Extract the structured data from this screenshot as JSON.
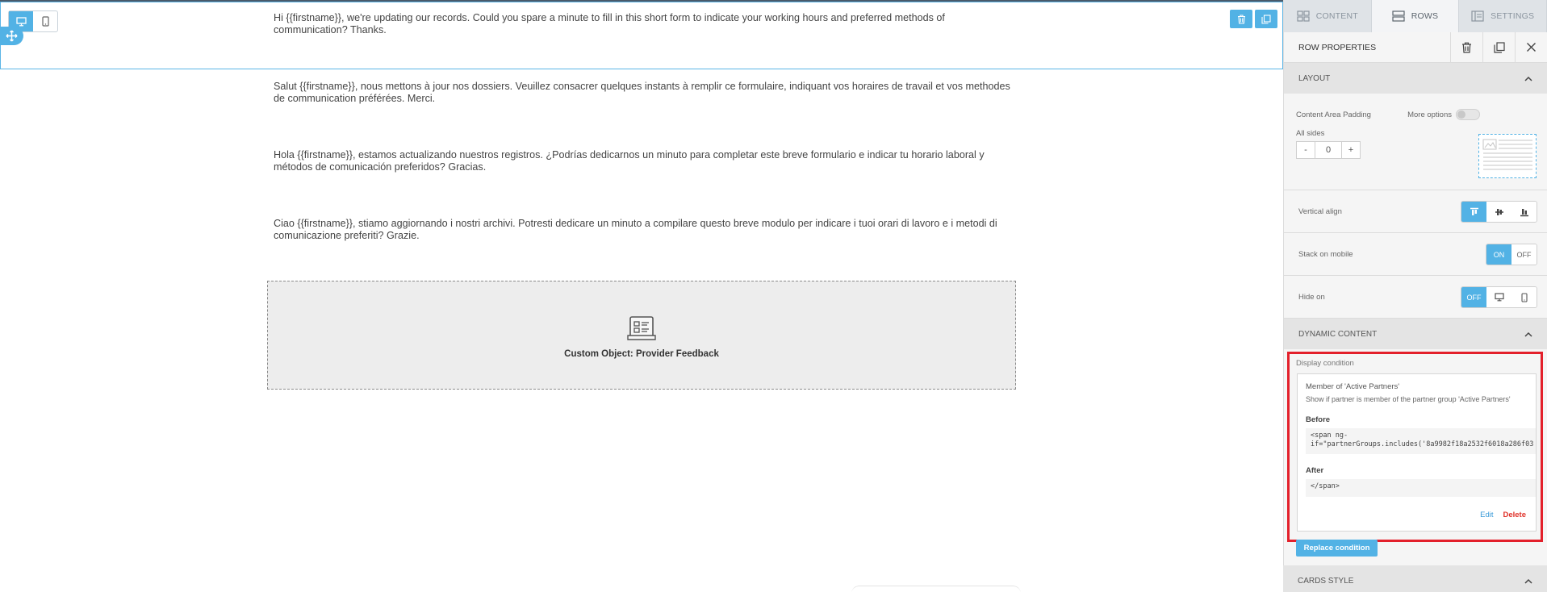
{
  "canvas": {
    "messages": [
      "Hi {{firstname}}, we're updating our records. Could you spare a minute to fill in this short form to indicate your working hours and preferred methods of communication? Thanks.",
      "Salut {{firstname}}, nous mettons à jour nos dossiers. Veuillez consacrer quelques instants à remplir ce formulaire, indiquant vos horaires de travail et vos methodes de communication préférées. Merci.",
      "Hola {{firstname}}, estamos actualizando nuestros registros. ¿Podrías dedicarnos un minuto para completar este breve formulario e indicar tu horario laboral y métodos de comunicación preferidos? Gracias.",
      "Ciao {{firstname}}, stiamo aggiornando i nostri archivi. Potresti dedicare un minuto a compilare questo breve modulo per indicare i tuoi orari di lavoro e i metodi di comunicazione preferiti? Grazie."
    ],
    "custom_object_label": "Custom Object: Provider Feedback"
  },
  "panel": {
    "tabs": [
      {
        "label": "CONTENT",
        "icon": "grid-icon",
        "active": false
      },
      {
        "label": "ROWS",
        "icon": "rows-icon",
        "active": true
      },
      {
        "label": "SETTINGS",
        "icon": "settings-icon",
        "active": false
      }
    ],
    "header_title": "ROW PROPERTIES",
    "layout": {
      "title": "LAYOUT",
      "padding_label": "Content Area Padding",
      "more_options_label": "More options",
      "all_sides_label": "All sides",
      "minus": "-",
      "value": "0",
      "plus": "+"
    },
    "vertical_align_label": "Vertical align",
    "stack_on_mobile": {
      "label": "Stack on mobile",
      "on": "ON",
      "off": "OFF"
    },
    "hide_on": {
      "label": "Hide on",
      "off": "OFF"
    },
    "dynamic_content": {
      "title": "DYNAMIC CONTENT",
      "display_condition_label": "Display condition",
      "condition_title": "Member of 'Active Partners'",
      "condition_desc": "Show if partner is member of the partner group 'Active Partners'",
      "before_label": "Before",
      "before_code": "<span ng-\nif=\"partnerGroups.includes('8a9982f18a2532f6018a286f03",
      "after_label": "After",
      "after_code": "</span>",
      "edit": "Edit",
      "delete": "Delete",
      "replace": "Replace condition"
    },
    "cards_style_title": "CARDS STYLE"
  },
  "colors": {
    "accent": "#52b2e5",
    "highlight": "#e3202b",
    "delete": "#e0332b"
  }
}
